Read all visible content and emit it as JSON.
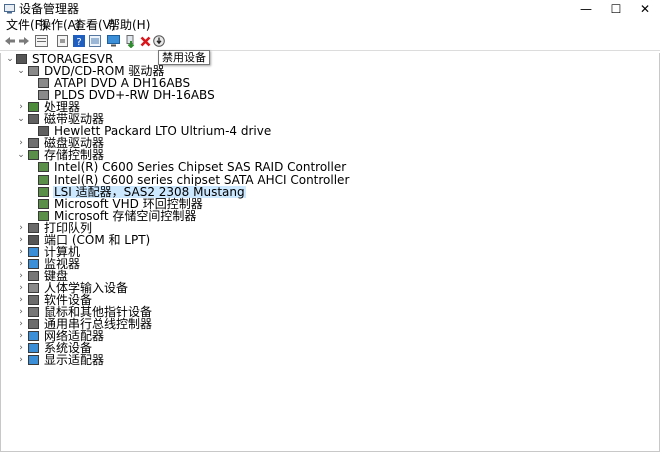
{
  "window": {
    "title": "设备管理器",
    "minimize": "—",
    "maximize": "☐",
    "close": "✕"
  },
  "menu": [
    "文件(F)",
    "操作(A)",
    "查看(V)",
    "帮助(H)"
  ],
  "toolbar": {
    "buttons": [
      "back-icon",
      "forward-icon",
      "properties-icon",
      "help-page-icon",
      "help-icon",
      "view-icon",
      "monitor-icon",
      "update-driver-icon",
      "uninstall-icon",
      "disable-device-icon"
    ],
    "tooltip": "禁用设备"
  },
  "tree": {
    "root": "STORAGESVR",
    "nodes": [
      {
        "label": "DVD/CD-ROM 驱动器",
        "expanded": true,
        "icon": "dvd-drive-icon",
        "children": [
          {
            "label": "ATAPI DVD A  DH16ABS",
            "icon": "dvd-drive-icon"
          },
          {
            "label": "PLDS DVD+-RW DH-16ABS",
            "icon": "dvd-drive-icon"
          }
        ]
      },
      {
        "label": "处理器",
        "expanded": false,
        "icon": "processor-icon"
      },
      {
        "label": "磁带驱动器",
        "expanded": true,
        "icon": "tape-drive-icon",
        "children": [
          {
            "label": "Hewlett Packard LTO Ultrium-4 drive",
            "icon": "tape-drive-icon"
          }
        ]
      },
      {
        "label": "磁盘驱动器",
        "expanded": false,
        "icon": "disk-drive-icon"
      },
      {
        "label": "存储控制器",
        "expanded": true,
        "icon": "storage-controller-icon",
        "children": [
          {
            "label": "Intel(R) C600 Series Chipset SAS RAID Controller",
            "icon": "storage-controller-icon"
          },
          {
            "label": "Intel(R) C600 series chipset SATA AHCI Controller",
            "icon": "storage-controller-icon"
          },
          {
            "label": "LSI 适配器，SAS2 2308 Mustang",
            "icon": "storage-controller-icon",
            "selected": true
          },
          {
            "label": "Microsoft VHD 环回控制器",
            "icon": "storage-controller-icon"
          },
          {
            "label": "Microsoft 存储空间控制器",
            "icon": "storage-controller-icon"
          }
        ]
      },
      {
        "label": "打印队列",
        "expanded": false,
        "icon": "printer-icon"
      },
      {
        "label": "端口 (COM 和 LPT)",
        "expanded": false,
        "icon": "port-icon"
      },
      {
        "label": "计算机",
        "expanded": false,
        "icon": "computer-icon"
      },
      {
        "label": "监视器",
        "expanded": false,
        "icon": "monitor-icon"
      },
      {
        "label": "键盘",
        "expanded": false,
        "icon": "keyboard-icon"
      },
      {
        "label": "人体学输入设备",
        "expanded": false,
        "icon": "hid-icon"
      },
      {
        "label": "软件设备",
        "expanded": false,
        "icon": "software-device-icon"
      },
      {
        "label": "鼠标和其他指针设备",
        "expanded": false,
        "icon": "mouse-icon"
      },
      {
        "label": "通用串行总线控制器",
        "expanded": false,
        "icon": "usb-icon"
      },
      {
        "label": "网络适配器",
        "expanded": false,
        "icon": "network-adapter-icon"
      },
      {
        "label": "系统设备",
        "expanded": false,
        "icon": "system-device-icon"
      },
      {
        "label": "显示适配器",
        "expanded": false,
        "icon": "display-adapter-icon"
      }
    ]
  },
  "colors": {
    "selection": "#cce8ff",
    "border": "#c8c8c8",
    "help_blue": "#1f5fbf",
    "uninstall_red": "#d9161c",
    "driver_green": "#2e8b2e"
  }
}
